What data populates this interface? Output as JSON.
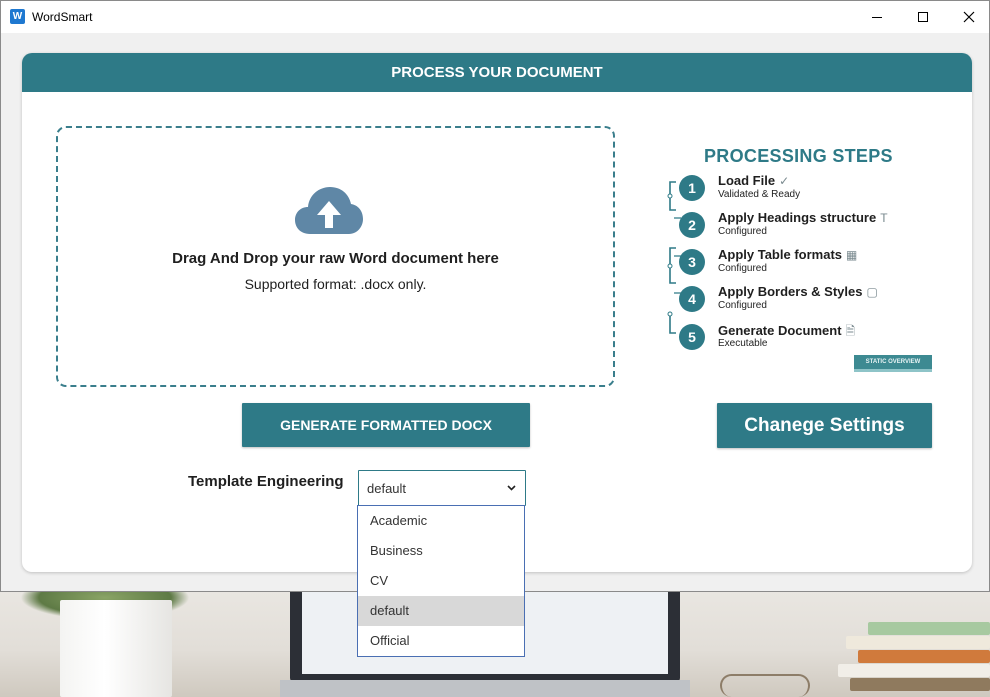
{
  "window": {
    "title": "WordSmart",
    "app_icon_glyph": "W"
  },
  "card": {
    "header": "PROCESS YOUR DOCUMENT"
  },
  "dropzone": {
    "title": "Drag And Drop your raw Word document here",
    "subtitle": "Supported format: .docx only.",
    "icon": "cloud-upload-icon"
  },
  "steps": {
    "title": "PROCESSING STEPS",
    "badge": "STATIC OVERVIEW",
    "items": [
      {
        "num": "1",
        "label": "Load File",
        "status": "Validated & Ready",
        "icon": "check-circle-icon",
        "glyph": "✓"
      },
      {
        "num": "2",
        "label": "Apply Headings structure",
        "status": "Configured",
        "icon": "text-style-icon",
        "glyph": "T"
      },
      {
        "num": "3",
        "label": "Apply Table formats",
        "status": "Configured",
        "icon": "table-icon",
        "glyph": "▦"
      },
      {
        "num": "4",
        "label": "Apply Borders & Styles",
        "status": "Configured",
        "icon": "border-icon",
        "glyph": "▢"
      },
      {
        "num": "5",
        "label": "Generate Document",
        "status": "Executable",
        "icon": "document-arrow-icon",
        "glyph": "🗎"
      }
    ]
  },
  "buttons": {
    "generate": "GENERATE FORMATTED DOCX",
    "settings": "Chanege Settings"
  },
  "template": {
    "label": "Template Engineering",
    "value": "default",
    "options": [
      "Academic",
      "Business",
      "CV",
      "default",
      "Official"
    ],
    "selected_index": 3
  },
  "colors": {
    "accent": "#2e7a87",
    "dropdown_border": "#4a6fb3",
    "selected_option": "#d8d8d8"
  }
}
